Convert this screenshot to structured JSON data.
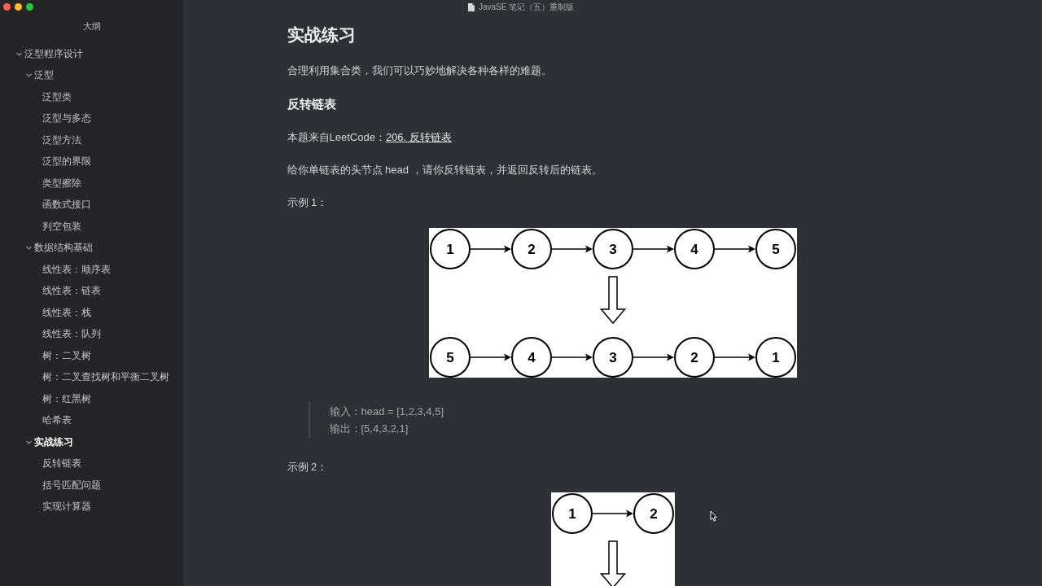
{
  "window": {
    "title": "JavaSE 笔记（五）重制版"
  },
  "sidebar": {
    "title": "大纲",
    "items": [
      {
        "label": "泛型程序设计",
        "expanded": true,
        "selected": false,
        "children": [
          {
            "label": "泛型",
            "expanded": true,
            "selected": false,
            "children": [
              {
                "label": "泛型类",
                "selected": false
              },
              {
                "label": "泛型与多态",
                "selected": false
              },
              {
                "label": "泛型方法",
                "selected": false
              },
              {
                "label": "泛型的界限",
                "selected": false
              },
              {
                "label": "类型擦除",
                "selected": false
              },
              {
                "label": "函数式接口",
                "selected": false
              },
              {
                "label": "判空包装",
                "selected": false
              }
            ]
          },
          {
            "label": "数据结构基础",
            "expanded": true,
            "selected": false,
            "children": [
              {
                "label": "线性表：顺序表",
                "selected": false
              },
              {
                "label": "线性表：链表",
                "selected": false
              },
              {
                "label": "线性表：栈",
                "selected": false
              },
              {
                "label": "线性表：队列",
                "selected": false
              },
              {
                "label": "树：二叉树",
                "selected": false
              },
              {
                "label": "树：二叉查找树和平衡二叉树",
                "selected": false
              },
              {
                "label": "树：红黑树",
                "selected": false
              },
              {
                "label": "哈希表",
                "selected": false
              }
            ]
          },
          {
            "label": "实战练习",
            "expanded": true,
            "selected": true,
            "children": [
              {
                "label": "反转链表",
                "selected": false
              },
              {
                "label": "括号匹配问题",
                "selected": false
              },
              {
                "label": "实现计算器",
                "selected": false
              }
            ]
          }
        ]
      }
    ]
  },
  "document": {
    "blocks": [
      {
        "kind": "heading1",
        "text": "实战练习"
      },
      {
        "kind": "paragraph",
        "text": "合理利用集合类，我们可以巧妙地解决各种各样的难题。"
      },
      {
        "kind": "heading3",
        "text": "反转链表"
      },
      {
        "kind": "paragraph",
        "text": "本题来自LeetCode：",
        "link": "206. 反转链表"
      },
      {
        "kind": "paragraph",
        "text": "给你单链表的头节点 head ，请你反转链表，并返回反转后的链表。"
      },
      {
        "kind": "paragraph",
        "text": "示例 1："
      },
      {
        "kind": "figure",
        "before": [
          "1",
          "2",
          "3",
          "4",
          "5"
        ],
        "after": [
          "5",
          "4",
          "3",
          "2",
          "1"
        ]
      },
      {
        "kind": "quote",
        "lines": [
          "输入：head = [1,2,3,4,5]",
          "输出：[5,4,3,2,1]"
        ]
      },
      {
        "kind": "paragraph",
        "text": "示例 2："
      },
      {
        "kind": "figure",
        "before": [
          "1",
          "2"
        ]
      }
    ]
  }
}
